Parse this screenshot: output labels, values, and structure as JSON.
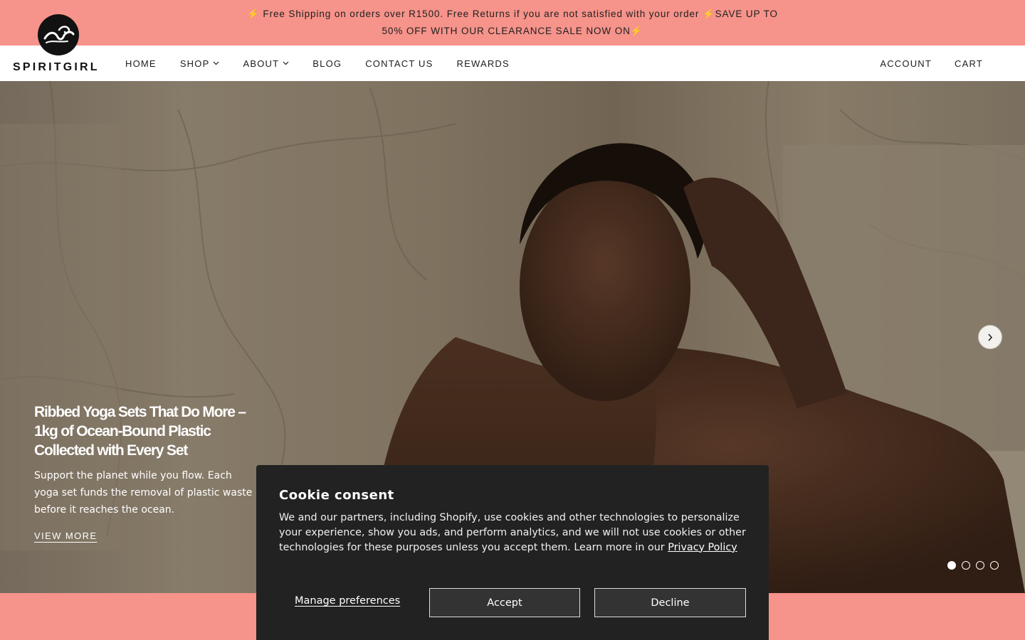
{
  "announcement": {
    "text": "⚡ Free Shipping on orders over R1500. Free Returns if you are not satisfied with your order ⚡SAVE UP TO 50% OFF WITH OUR CLEARANCE SALE NOW ON⚡"
  },
  "brand": {
    "logo_text": "SPIRITGIRL"
  },
  "nav": {
    "items": [
      {
        "label": "HOME",
        "dropdown": false
      },
      {
        "label": "SHOP",
        "dropdown": true
      },
      {
        "label": "ABOUT",
        "dropdown": true
      },
      {
        "label": "BLOG",
        "dropdown": false
      },
      {
        "label": "CONTACT US",
        "dropdown": false
      },
      {
        "label": "REWARDS",
        "dropdown": false
      }
    ],
    "account_label": "ACCOUNT",
    "cart_label": "CART"
  },
  "hero": {
    "title": "Ribbed Yoga Sets That Do More – 1kg of Ocean-Bound Plastic Collected with Every Set",
    "subtitle": "Support the planet while you flow. Each yoga set funds the removal of plastic waste before it reaches the ocean.",
    "cta_label": "VIEW MORE",
    "slide_count": 4,
    "active_slide": 1
  },
  "cookie": {
    "title": "Cookie consent",
    "body": "We and our partners, including Shopify, use cookies and other technologies to personalize your experience, show you ads, and perform analytics, and we will not use cookies or other technologies for these purposes unless you accept them. Learn more in our",
    "privacy_link": "Privacy Policy",
    "manage_label": "Manage preferences",
    "accept_label": "Accept",
    "decline_label": "Decline"
  },
  "colors": {
    "announcement_bg": "#f6938a",
    "cookie_bg": "#222222",
    "button_bg": "#333333"
  },
  "icons": [
    "wave-logo-icon",
    "chevron-down-icon",
    "chevron-right-icon"
  ]
}
